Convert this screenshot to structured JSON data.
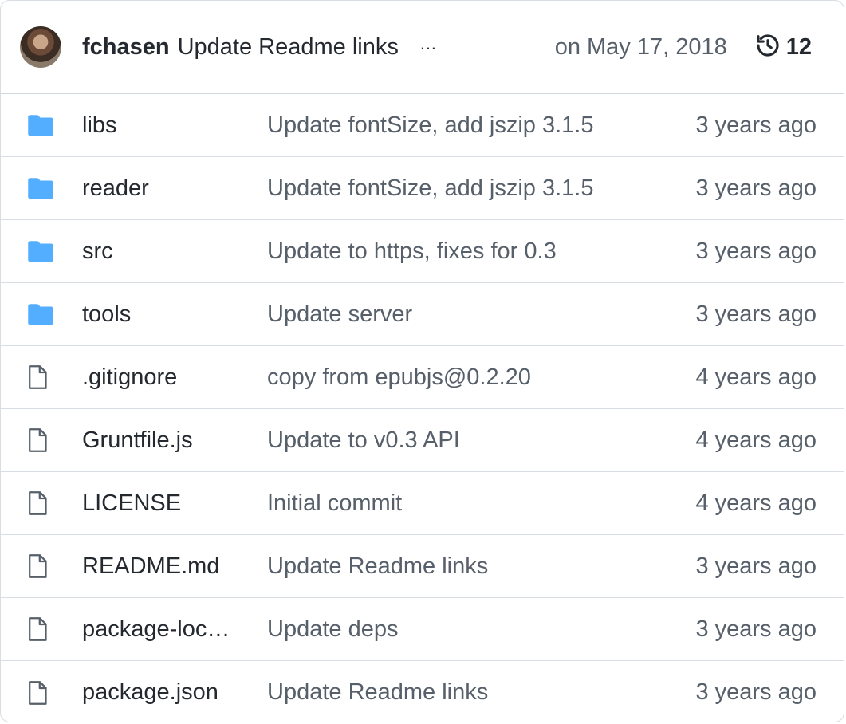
{
  "latest_commit": {
    "author": "fchasen",
    "message": "Update Readme links",
    "ellipsis": "…",
    "date": "on May 17, 2018",
    "history_count": "12",
    "history_icon": "history-icon",
    "avatar_icon": "avatar"
  },
  "colors": {
    "folder": "#54aeff",
    "file_icon": "#57606a",
    "primary_text": "#24292f",
    "muted_text": "#57606a",
    "border": "#d8dee4"
  },
  "files": [
    {
      "type": "folder",
      "icon": "folder-icon",
      "name": "libs",
      "commit": "Update fontSize, add jszip 3.1.5",
      "age": "3 years ago"
    },
    {
      "type": "folder",
      "icon": "folder-icon",
      "name": "reader",
      "commit": "Update fontSize, add jszip 3.1.5",
      "age": "3 years ago"
    },
    {
      "type": "folder",
      "icon": "folder-icon",
      "name": "src",
      "commit": "Update to https, fixes for 0.3",
      "age": "3 years ago"
    },
    {
      "type": "folder",
      "icon": "folder-icon",
      "name": "tools",
      "commit": "Update server",
      "age": "3 years ago"
    },
    {
      "type": "file",
      "icon": "file-icon",
      "name": ".gitignore",
      "commit": "copy from epubjs@0.2.20",
      "age": "4 years ago"
    },
    {
      "type": "file",
      "icon": "file-icon",
      "name": "Gruntfile.js",
      "commit": "Update to v0.3 API",
      "age": "4 years ago"
    },
    {
      "type": "file",
      "icon": "file-icon",
      "name": "LICENSE",
      "commit": "Initial commit",
      "age": "4 years ago"
    },
    {
      "type": "file",
      "icon": "file-icon",
      "name": "README.md",
      "commit": "Update Readme links",
      "age": "3 years ago"
    },
    {
      "type": "file",
      "icon": "file-icon",
      "name": "package-loc…",
      "commit": "Update deps",
      "age": "3 years ago"
    },
    {
      "type": "file",
      "icon": "file-icon",
      "name": "package.json",
      "commit": "Update Readme links",
      "age": "3 years ago"
    }
  ]
}
